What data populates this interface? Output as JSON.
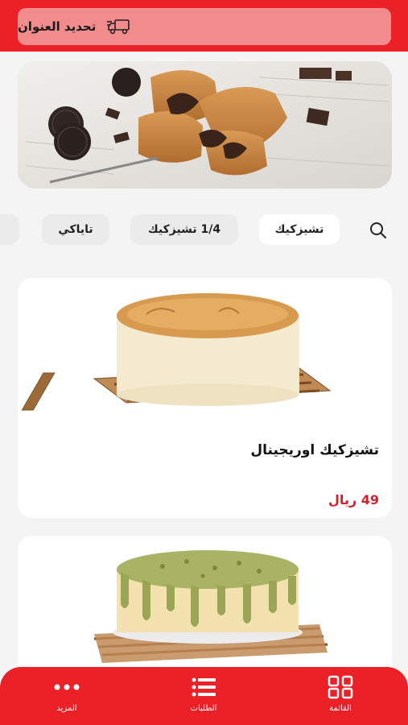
{
  "header": {
    "address_label": "تحديد العنوان",
    "icon": "delivery-truck-icon"
  },
  "categories": [
    {
      "label": "تشيزكيك",
      "active": true
    },
    {
      "label": "1/4 تشيزكيك",
      "active": false
    },
    {
      "label": "تاياكي",
      "active": false
    }
  ],
  "search_icon": "search-icon",
  "products": [
    {
      "name": "تشيزكيك اوريجينال",
      "price": "49 ريال"
    },
    {
      "name": "",
      "price": ""
    }
  ],
  "bottom_nav": {
    "items": [
      {
        "label": "المزيد",
        "icon": "more-dots-icon"
      },
      {
        "label": "الطلبات",
        "icon": "list-icon"
      },
      {
        "label": "القائمة",
        "icon": "grid-icon"
      }
    ]
  },
  "colors": {
    "brand_red": "#ec2027",
    "pill_pink": "#f28b8b",
    "price_red": "#d4202a"
  }
}
